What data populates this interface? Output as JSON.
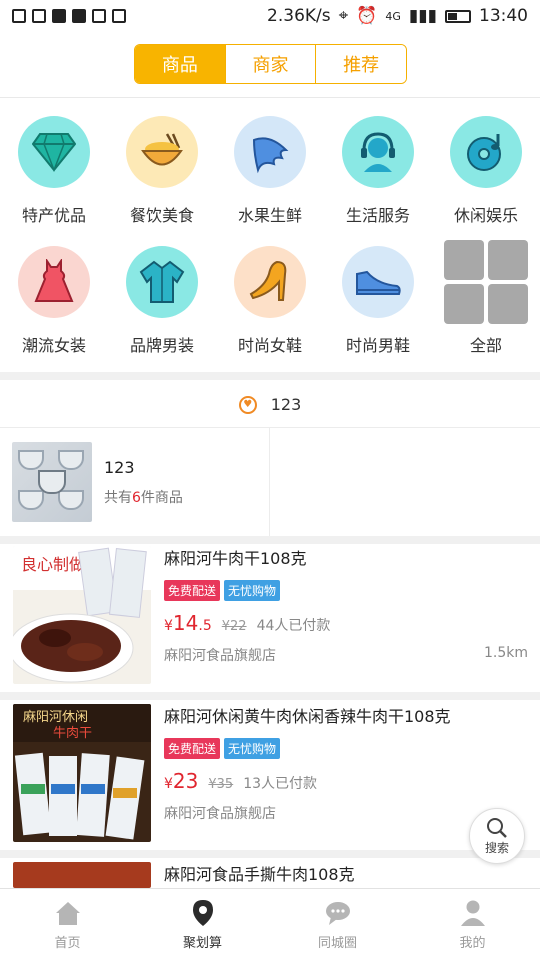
{
  "status_bar": {
    "speed": "2.36K/s",
    "network": "4G",
    "time": "13:40"
  },
  "tabs": [
    {
      "label": "商品",
      "active": true
    },
    {
      "label": "商家",
      "active": false
    },
    {
      "label": "推荐",
      "active": false
    }
  ],
  "categories": [
    {
      "label": "特产优品",
      "icon": "diamond-icon",
      "bg": "#7fe3e0"
    },
    {
      "label": "餐饮美食",
      "icon": "food-bowl-icon",
      "bg": "#fde9b6"
    },
    {
      "label": "水果生鲜",
      "icon": "wing-icon",
      "bg": "#cfe4f7"
    },
    {
      "label": "生活服务",
      "icon": "headset-icon",
      "bg": "#7fe3e0"
    },
    {
      "label": "休闲娱乐",
      "icon": "music-disc-icon",
      "bg": "#7fe3e0"
    },
    {
      "label": "潮流女装",
      "icon": "dress-icon",
      "bg": "#fad6d0"
    },
    {
      "label": "品牌男装",
      "icon": "shirt-icon",
      "bg": "#7fe3e0"
    },
    {
      "label": "时尚女鞋",
      "icon": "high-heel-icon",
      "bg": "#fde0c8"
    },
    {
      "label": "时尚男鞋",
      "icon": "shoe-icon",
      "bg": "#d6e8f8"
    },
    {
      "label": "全部",
      "icon": "grid-icon",
      "bg": ""
    }
  ],
  "section": {
    "title": "123"
  },
  "featured": {
    "name": "123",
    "count_prefix": "共有",
    "count": "6",
    "count_suffix": "件商品"
  },
  "products": [
    {
      "title": "麻阳河牛肉干108克",
      "tag1": "免费配送",
      "tag2": "无忧购物",
      "currency": "¥",
      "price_int": "14",
      "price_dec": ".5",
      "old_price": "¥22",
      "sold": "44人已付款",
      "shop": "麻阳河食品旗舰店",
      "distance": "1.5km"
    },
    {
      "title": "麻阳河休闲黄牛肉休闲香辣牛肉干108克",
      "tag1": "免费配送",
      "tag2": "无忧购物",
      "currency": "¥",
      "price_int": "23",
      "price_dec": "",
      "old_price": "¥35",
      "sold": "13人已付款",
      "shop": "麻阳河食品旗舰店",
      "distance": ""
    },
    {
      "title": "麻阳河食品手撕牛肉108克"
    }
  ],
  "float_search": {
    "label": "搜索"
  },
  "bottom_nav": [
    {
      "label": "首页",
      "active": false
    },
    {
      "label": "聚划算",
      "active": true
    },
    {
      "label": "同城圈",
      "active": false
    },
    {
      "label": "我的",
      "active": false
    }
  ]
}
